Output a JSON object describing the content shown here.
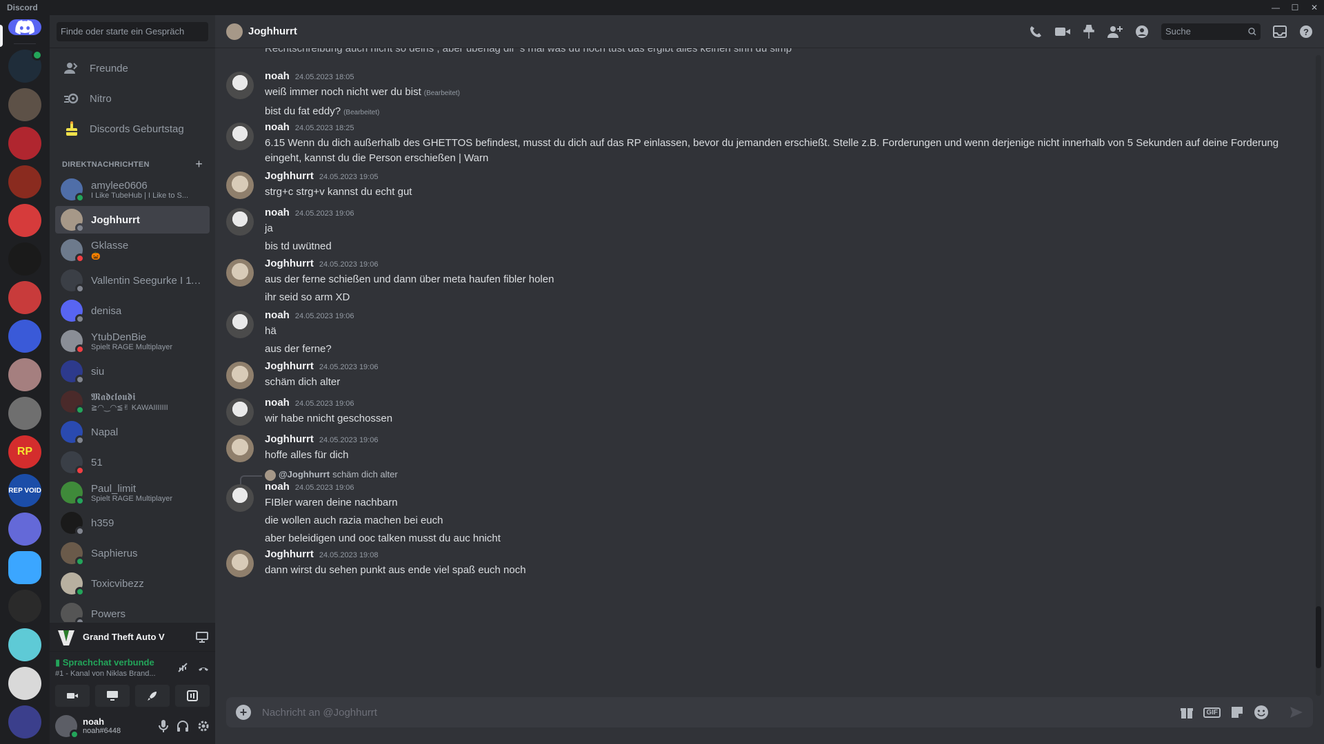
{
  "app": {
    "title": "Discord",
    "window_controls": [
      "—",
      "☐",
      "✕"
    ]
  },
  "guilds": [
    {
      "color": "#1f2d3a",
      "online": true
    },
    {
      "color": "#5d5147",
      "online": false
    },
    {
      "color": "#b0262f",
      "online": false
    },
    {
      "color": "#8a2b1f",
      "online": false
    },
    {
      "color": "#d63b3b",
      "online": false
    },
    {
      "color": "#1a1a1a",
      "online": false
    },
    {
      "color": "#c83b3b",
      "online": false
    },
    {
      "color": "#3a5ad8",
      "online": false
    },
    {
      "color": "#a57f7f",
      "online": false
    },
    {
      "color": "#6f6f6f",
      "online": false
    },
    {
      "color": "#d42d2d",
      "online": false
    },
    {
      "color": "#1b4da8",
      "online": false
    },
    {
      "color": "#6469d8",
      "online": false
    },
    {
      "color": "#3ba6ff",
      "online": false
    },
    {
      "color": "#2a2a2a",
      "online": false
    },
    {
      "color": "#5ecad6",
      "online": false
    },
    {
      "color": "#d9d9d9",
      "online": false
    },
    {
      "color": "#3b3f8c",
      "online": false
    }
  ],
  "guild_labels": {
    "rep_void": "REP VOID",
    "rp": "RP"
  },
  "sidebar": {
    "search_placeholder": "Finde oder starte ein Gespräch",
    "nav": [
      {
        "label": "Freunde",
        "icon": "friends-icon"
      },
      {
        "label": "Nitro",
        "icon": "nitro-icon"
      },
      {
        "label": "Discords Geburtstag",
        "icon": "cake-icon"
      }
    ],
    "dm_header": "DIREKTNACHRICHTEN",
    "dms": [
      {
        "name": "amylee0606",
        "sub": "I Like TubeHub | I Like to S...",
        "status": "online",
        "color": "#4f6ea8"
      },
      {
        "name": "Joghhurrt",
        "sub": "",
        "status": "offline",
        "color": "#a69888",
        "active": true
      },
      {
        "name": "Gklasse",
        "sub": "🎃",
        "status": "dnd",
        "color": "#6d7a8c"
      },
      {
        "name": "Vallentin Seegurke I 11...",
        "sub": "",
        "status": "offline",
        "color": "#3b3f46"
      },
      {
        "name": "denisa",
        "sub": "",
        "status": "offline",
        "color": "#5865f2"
      },
      {
        "name": "YtubDenBie",
        "sub": "Spielt RAGE Multiplayer",
        "status": "dnd",
        "color": "#8a8e96"
      },
      {
        "name": "siu",
        "sub": "",
        "status": "offline",
        "color": "#2d3a8c"
      },
      {
        "name": "𝕸𝖆𝖉𝖈𝖑𝖔𝖚𝖉𝖎",
        "sub": "≧◠‿◠≦✌ KAWAIIIIIII",
        "status": "online",
        "color": "#4a2a2a"
      },
      {
        "name": "Napal",
        "sub": "",
        "status": "offline",
        "color": "#2a4ab0"
      },
      {
        "name": "51",
        "sub": "",
        "status": "dnd",
        "color": "#3a3f47"
      },
      {
        "name": "Paul_limit",
        "sub": "Spielt RAGE Multiplayer",
        "status": "online",
        "color": "#3f8a3a"
      },
      {
        "name": "h359",
        "sub": "",
        "status": "offline",
        "color": "#1a1a1a"
      },
      {
        "name": "Saphierus",
        "sub": "",
        "status": "online",
        "color": "#6a5a4a"
      },
      {
        "name": "Toxicvibezz",
        "sub": "",
        "status": "online",
        "color": "#b8b0a0"
      },
      {
        "name": "Powers",
        "sub": "",
        "status": "offline",
        "color": "#555"
      }
    ],
    "game": {
      "name": "Grand Theft Auto V"
    },
    "voice": {
      "status": "Sprachchat verbunde",
      "channel": "#1 - Kanal von Niklas Brand..."
    },
    "user": {
      "name": "noah",
      "tag": "noah#6448"
    }
  },
  "chat": {
    "recipient": "Joghhurrt",
    "search_placeholder": "Suche",
    "cut_top_text": "Rechtschreibung auch nicht so deins , aber überlag dir 's mal was du noch tust das ergibt alles keinen sinn du simp",
    "messages": [
      {
        "author": "noah",
        "time": "24.05.2023 18:05",
        "lines": [
          {
            "t": "weiß immer noch nicht wer du bist",
            "edited": "(Bearbeitet)"
          },
          {
            "t": "bist du fat eddy?",
            "edited": "(Bearbeitet)"
          }
        ]
      },
      {
        "author": "noah",
        "time": "24.05.2023 18:25",
        "lines": [
          {
            "t": "6.15 Wenn du dich außerhalb des GHETTOS befindest, musst du dich auf das RP einlassen, bevor du jemanden erschießt. Stelle z.B. Forderungen und wenn derjenige nicht innerhalb von 5 Sekunden auf deine Forderung eingeht, kannst du die Person erschießen | Warn"
          }
        ]
      },
      {
        "author": "Joghhurrt",
        "time": "24.05.2023 19:05",
        "lines": [
          {
            "t": "strg+c strg+v    kannst du echt gut"
          }
        ]
      },
      {
        "author": "noah",
        "time": "24.05.2023 19:06",
        "lines": [
          {
            "t": "ja"
          },
          {
            "t": "bis td uwütned"
          }
        ]
      },
      {
        "author": "Joghhurrt",
        "time": "24.05.2023 19:06",
        "lines": [
          {
            "t": "aus der ferne schießen und dann über meta haufen fibler holen"
          },
          {
            "t": "ihr seid so arm XD"
          }
        ]
      },
      {
        "author": "noah",
        "time": "24.05.2023 19:06",
        "lines": [
          {
            "t": "hä"
          },
          {
            "t": "aus der ferne?"
          }
        ]
      },
      {
        "author": "Joghhurrt",
        "time": "24.05.2023 19:06",
        "lines": [
          {
            "t": "schäm dich alter"
          }
        ]
      },
      {
        "author": "noah",
        "time": "24.05.2023 19:06",
        "lines": [
          {
            "t": "wir habe nnicht geschossen"
          }
        ]
      },
      {
        "author": "Joghhurrt",
        "time": "24.05.2023 19:06",
        "lines": [
          {
            "t": "hoffe alles für dich"
          }
        ]
      },
      {
        "author": "noah",
        "time": "24.05.2023 19:06",
        "reply": {
          "name": "@Joghhurrt",
          "text": "schäm dich alter"
        },
        "lines": [
          {
            "t": "FIBler waren deine nachbarn"
          },
          {
            "t": "die wollen auch razia machen bei euch"
          },
          {
            "t": "aber beleidigen und ooc talken musst du auc hnicht"
          }
        ]
      },
      {
        "author": "Joghhurrt",
        "time": "24.05.2023 19:08",
        "lines": [
          {
            "t": "dann wirst du sehen punkt aus ende viel spaß euch noch"
          }
        ]
      }
    ],
    "composer_placeholder": "Nachricht an @Joghhurrt",
    "gif_label": "GIF"
  }
}
